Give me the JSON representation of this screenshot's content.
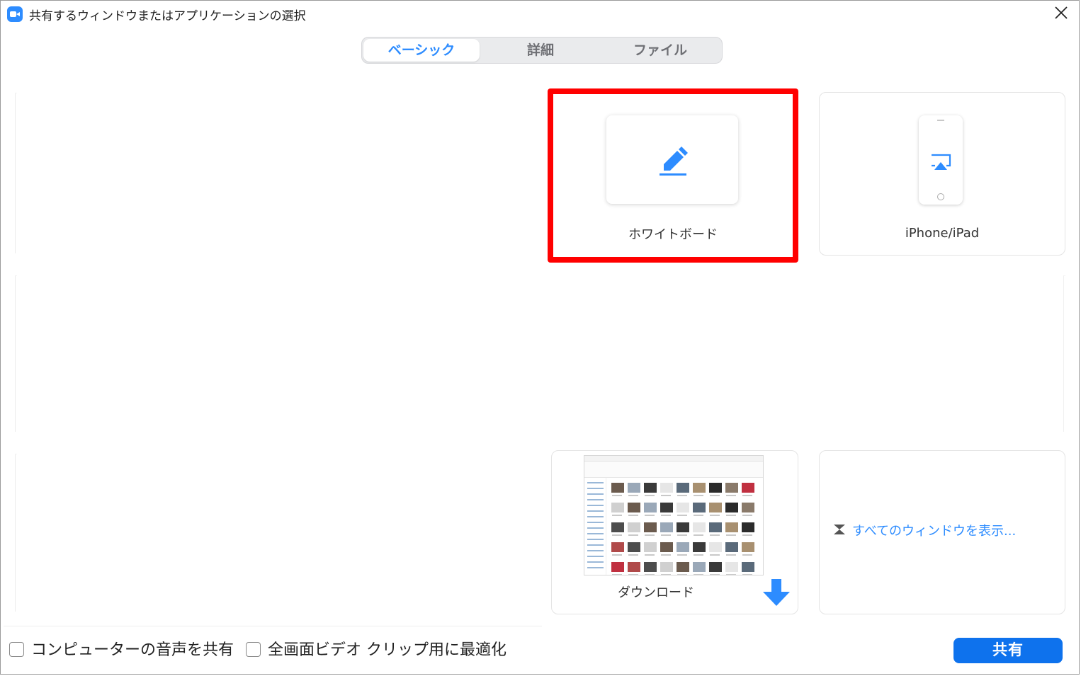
{
  "window": {
    "title": "共有するウィンドウまたはアプリケーションの選択"
  },
  "tabs": [
    {
      "label": "ベーシック",
      "active": true
    },
    {
      "label": "詳細",
      "active": false
    },
    {
      "label": "ファイル",
      "active": false
    }
  ],
  "tiles": {
    "whiteboard": {
      "label": "ホワイトボード",
      "icon": "pencil-icon",
      "highlighted": true
    },
    "iphone_ipad": {
      "label": "iPhone/iPad",
      "icon": "airplay-icon"
    },
    "downloads": {
      "label": "ダウンロード",
      "icon": "download-arrow-icon"
    },
    "show_all": {
      "label": "すべてのウィンドウを表示...",
      "icon": "expand-icon"
    }
  },
  "options": {
    "share_audio": {
      "label": "コンピューターの音声を共有",
      "checked": false
    },
    "optimize_video": {
      "label": "全画面ビデオ クリップ用に最適化",
      "checked": false
    }
  },
  "share_button": {
    "label": "共有"
  },
  "colors": {
    "accent": "#2d8cff",
    "share_button": "#0e72ed",
    "highlight": "#ff0000"
  }
}
